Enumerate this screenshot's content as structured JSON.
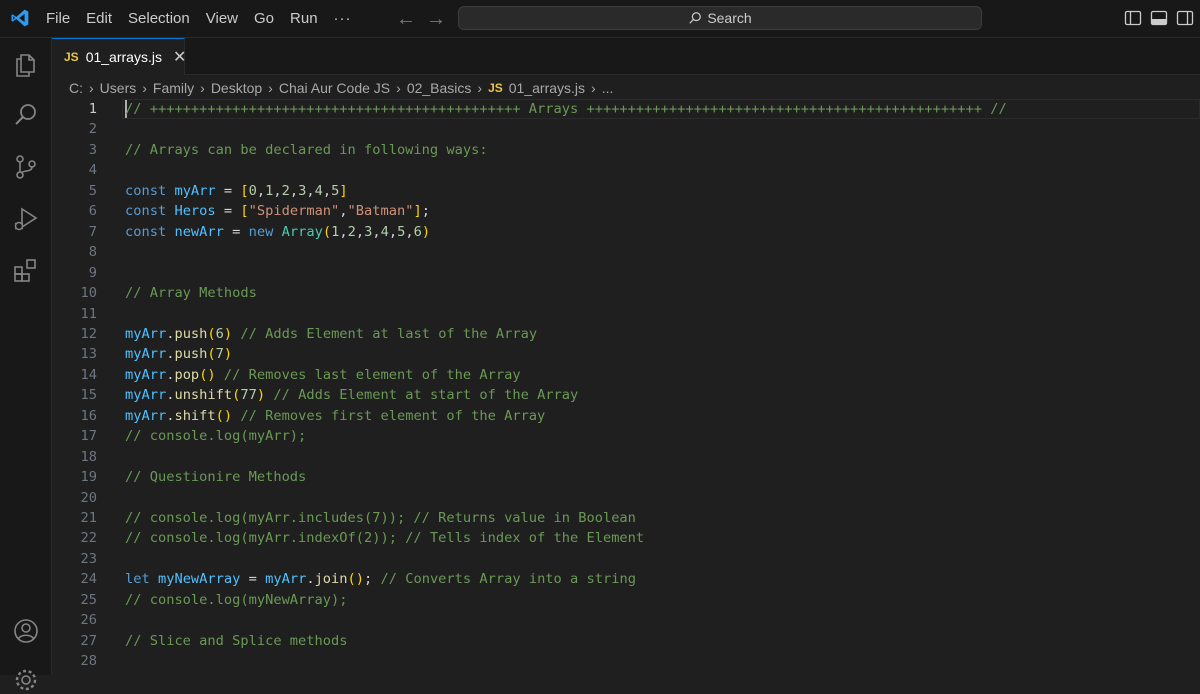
{
  "menu": {
    "items": [
      "File",
      "Edit",
      "Selection",
      "View",
      "Go",
      "Run"
    ],
    "more": "···"
  },
  "nav": {
    "back": "←",
    "forward": "→"
  },
  "search": {
    "label": "Search"
  },
  "tab": {
    "badge": "JS",
    "label": "01_arrays.js",
    "close": "✕"
  },
  "breadcrumb": {
    "parts": [
      "C:",
      "Users",
      "Family",
      "Desktop",
      "Chai Aur Code JS",
      "02_Basics"
    ],
    "file_badge": "JS",
    "file": "01_arrays.js",
    "ellipsis": "..."
  },
  "editor": {
    "active_line": 1,
    "lines": [
      [
        [
          "t-comment",
          "// +++++++++++++++++++++++++++++++++++++++++++++ Arrays ++++++++++++++++++++++++++++++++++++++++++++++++ //"
        ]
      ],
      [],
      [
        [
          "t-comment",
          "// Arrays can be declared in following ways:"
        ]
      ],
      [],
      [
        [
          "t-kw",
          "const "
        ],
        [
          "t-var",
          "myArr"
        ],
        [
          "t-op",
          " = "
        ],
        [
          "t-br",
          "["
        ],
        [
          "t-num",
          "0"
        ],
        [
          "t-op",
          ","
        ],
        [
          "t-num",
          "1"
        ],
        [
          "t-op",
          ","
        ],
        [
          "t-num",
          "2"
        ],
        [
          "t-op",
          ","
        ],
        [
          "t-num",
          "3"
        ],
        [
          "t-op",
          ","
        ],
        [
          "t-num",
          "4"
        ],
        [
          "t-op",
          ","
        ],
        [
          "t-num",
          "5"
        ],
        [
          "t-br",
          "]"
        ]
      ],
      [
        [
          "t-kw",
          "const "
        ],
        [
          "t-var",
          "Heros"
        ],
        [
          "t-op",
          " = "
        ],
        [
          "t-br",
          "["
        ],
        [
          "t-str",
          "\"Spiderman\""
        ],
        [
          "t-op",
          ","
        ],
        [
          "t-str",
          "\"Batman\""
        ],
        [
          "t-br",
          "]"
        ],
        [
          "t-op",
          ";"
        ]
      ],
      [
        [
          "t-kw",
          "const "
        ],
        [
          "t-var",
          "newArr"
        ],
        [
          "t-op",
          " = "
        ],
        [
          "t-kw",
          "new "
        ],
        [
          "t-cls",
          "Array"
        ],
        [
          "t-br",
          "("
        ],
        [
          "t-num",
          "1"
        ],
        [
          "t-op",
          ","
        ],
        [
          "t-num",
          "2"
        ],
        [
          "t-op",
          ","
        ],
        [
          "t-num",
          "3"
        ],
        [
          "t-op",
          ","
        ],
        [
          "t-num",
          "4"
        ],
        [
          "t-op",
          ","
        ],
        [
          "t-num",
          "5"
        ],
        [
          "t-op",
          ","
        ],
        [
          "t-num",
          "6"
        ],
        [
          "t-br",
          ")"
        ]
      ],
      [],
      [],
      [
        [
          "t-comment",
          "// Array Methods"
        ]
      ],
      [],
      [
        [
          "t-var",
          "myArr"
        ],
        [
          "t-op",
          "."
        ],
        [
          "t-fn",
          "push"
        ],
        [
          "t-br",
          "("
        ],
        [
          "t-num",
          "6"
        ],
        [
          "t-br",
          ")"
        ],
        [
          "t-op",
          " "
        ],
        [
          "t-comment",
          "// Adds Element at last of the Array"
        ]
      ],
      [
        [
          "t-var",
          "myArr"
        ],
        [
          "t-op",
          "."
        ],
        [
          "t-fn",
          "push"
        ],
        [
          "t-br",
          "("
        ],
        [
          "t-num",
          "7"
        ],
        [
          "t-br",
          ")"
        ]
      ],
      [
        [
          "t-var",
          "myArr"
        ],
        [
          "t-op",
          "."
        ],
        [
          "t-fn",
          "pop"
        ],
        [
          "t-br",
          "()"
        ],
        [
          "t-op",
          " "
        ],
        [
          "t-comment",
          "// Removes last element of the Array"
        ]
      ],
      [
        [
          "t-var",
          "myArr"
        ],
        [
          "t-op",
          "."
        ],
        [
          "t-fn",
          "unshift"
        ],
        [
          "t-br",
          "("
        ],
        [
          "t-num",
          "77"
        ],
        [
          "t-br",
          ")"
        ],
        [
          "t-op",
          " "
        ],
        [
          "t-comment",
          "// Adds Element at start of the Array"
        ]
      ],
      [
        [
          "t-var",
          "myArr"
        ],
        [
          "t-op",
          "."
        ],
        [
          "t-fn",
          "shift"
        ],
        [
          "t-br",
          "()"
        ],
        [
          "t-op",
          " "
        ],
        [
          "t-comment",
          "// Removes first element of the Array"
        ]
      ],
      [
        [
          "t-comment",
          "// console.log(myArr);"
        ]
      ],
      [],
      [
        [
          "t-comment",
          "// Questionire Methods"
        ]
      ],
      [],
      [
        [
          "t-comment",
          "// console.log(myArr.includes(7)); // Returns value in Boolean"
        ]
      ],
      [
        [
          "t-comment",
          "// console.log(myArr.indexOf(2)); // Tells index of the Element"
        ]
      ],
      [],
      [
        [
          "t-kw",
          "let "
        ],
        [
          "t-var",
          "myNewArray"
        ],
        [
          "t-op",
          " = "
        ],
        [
          "t-var",
          "myArr"
        ],
        [
          "t-op",
          "."
        ],
        [
          "t-fn",
          "join"
        ],
        [
          "t-br",
          "()"
        ],
        [
          "t-op",
          "; "
        ],
        [
          "t-comment",
          "// Converts Array into a string"
        ]
      ],
      [
        [
          "t-comment",
          "// console.log(myNewArray);"
        ]
      ],
      [],
      [
        [
          "t-comment",
          "// Slice and Splice methods"
        ]
      ],
      []
    ]
  }
}
